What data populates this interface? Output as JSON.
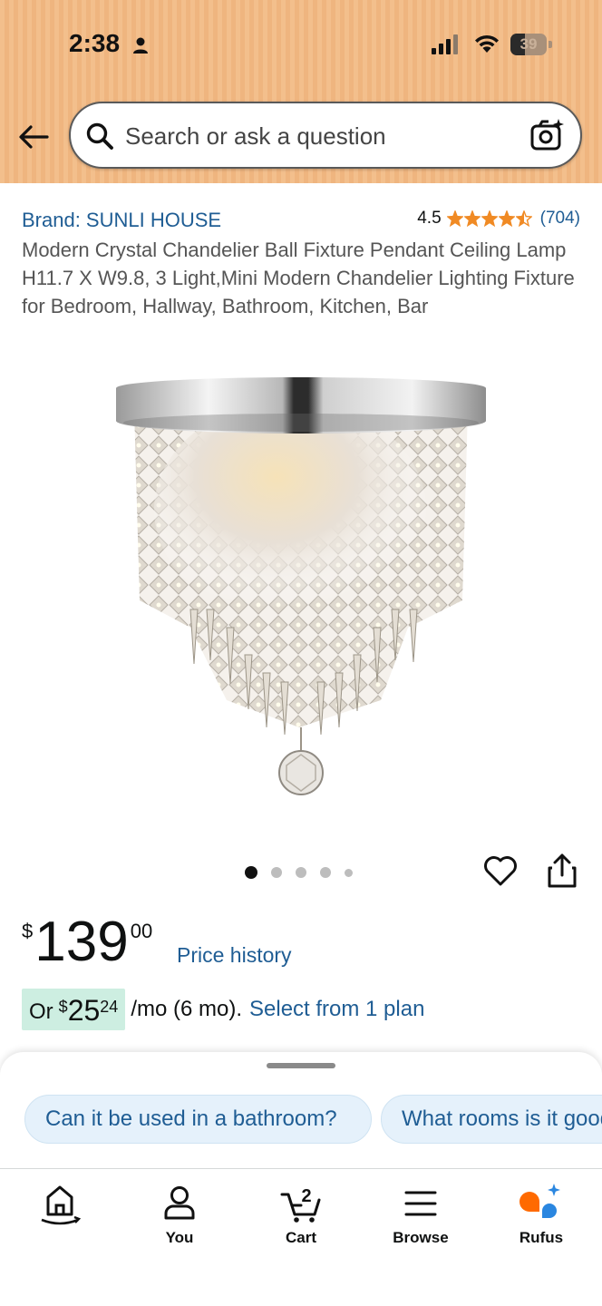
{
  "status_bar": {
    "time": "2:38",
    "battery": "39",
    "battery_level": 0.39
  },
  "search": {
    "placeholder": "Search or ask a question"
  },
  "product": {
    "brand": "Brand: SUNLI HOUSE",
    "rating": "4.5",
    "rating_stars": 4.5,
    "review_count": "(704)",
    "title": "Modern Crystal Chandelier Ball Fixture Pendant Ceiling Lamp H11.7 X W9.8, 3 Light,Mini Modern Chandelier Lighting Fixture for Bedroom, Hallway, Bathroom, Kitchen, Bar",
    "image_count": 5,
    "active_image": 1
  },
  "price": {
    "symbol": "$",
    "whole": "139",
    "fraction": "00",
    "history_link": "Price history"
  },
  "installment": {
    "prefix": "Or",
    "symbol": "$",
    "whole": "25",
    "fraction": "24",
    "period": "/mo (6 mo).",
    "link": "Select from 1 plan"
  },
  "rufus_questions": [
    "Can it be used in a bathroom?",
    "What rooms is it good for?"
  ],
  "nav": [
    {
      "label": "",
      "icon": "home-icon"
    },
    {
      "label": "You",
      "icon": "person-icon"
    },
    {
      "label": "Cart",
      "icon": "cart-icon",
      "badge": "2"
    },
    {
      "label": "Browse",
      "icon": "menu-icon"
    },
    {
      "label": "Rufus",
      "icon": "rufus-icon"
    }
  ],
  "colors": {
    "header": "#f3bf8c",
    "link": "#1f5d94",
    "star": "#f08a24",
    "installment_badge": "#cdeee1",
    "rufus_orange": "#ff6a00",
    "rufus_blue": "#2a86e0"
  }
}
